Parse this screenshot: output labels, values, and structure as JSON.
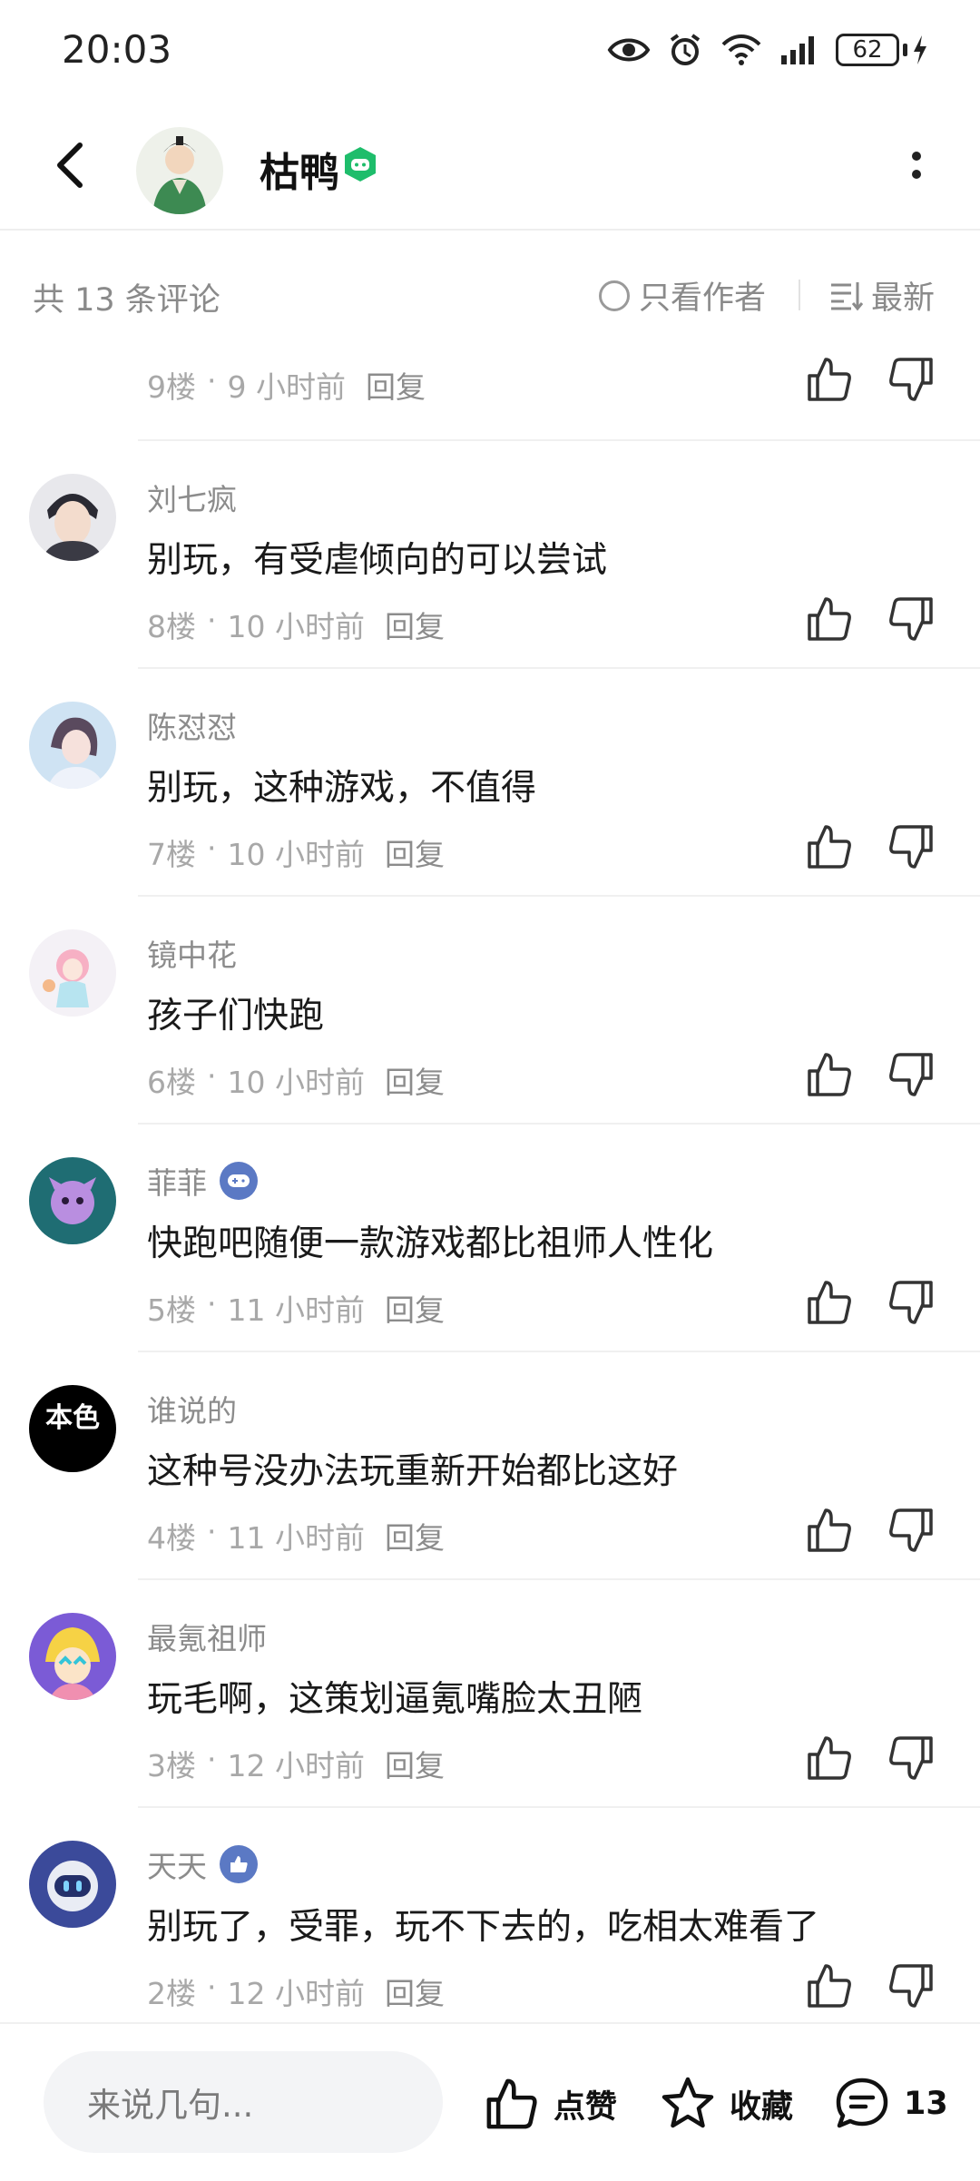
{
  "status_bar": {
    "time": "20:03",
    "battery": "62"
  },
  "header": {
    "title": "枯鸭"
  },
  "filter": {
    "count_label": "共 13 条评论",
    "author_only_label": "只看作者",
    "sort_label": "最新"
  },
  "comments": [
    {
      "floor": "9楼",
      "time": "9 小时前",
      "reply": "回复"
    },
    {
      "user": "刘七疯",
      "text": "别玩，有受虐倾向的可以尝试",
      "floor": "8楼",
      "time": "10 小时前",
      "reply": "回复"
    },
    {
      "user": "陈怼怼",
      "text": "别玩，这种游戏，不值得",
      "floor": "7楼",
      "time": "10 小时前",
      "reply": "回复"
    },
    {
      "user": "镜中花",
      "text": "孩子们快跑",
      "floor": "6楼",
      "time": "10 小时前",
      "reply": "回复"
    },
    {
      "user": "菲菲",
      "text": "快跑吧随便一款游戏都比祖师人性化",
      "floor": "5楼",
      "time": "11 小时前",
      "reply": "回复"
    },
    {
      "user": "谁说的",
      "text": "这种号没办法玩重新开始都比这好",
      "floor": "4楼",
      "time": "11 小时前",
      "reply": "回复"
    },
    {
      "user": "最氪祖师",
      "text": "玩毛啊，这策划逼氪嘴脸太丑陋",
      "floor": "3楼",
      "time": "12 小时前",
      "reply": "回复"
    },
    {
      "user": "天天",
      "text": "别玩了，受罪，玩不下去的，吃相太难看了",
      "floor": "2楼",
      "time": "12 小时前",
      "reply": "回复"
    }
  ],
  "bottom_bar": {
    "input_placeholder": "来说几句...",
    "like_label": "点赞",
    "favorite_label": "收藏",
    "comment_count": "13"
  },
  "avatar_text": {
    "c4": "本色"
  },
  "colors": {
    "accent_green": "#1ebd6b",
    "badge_blue": "#5b79c4",
    "text_secondary": "#8c8c8c"
  }
}
